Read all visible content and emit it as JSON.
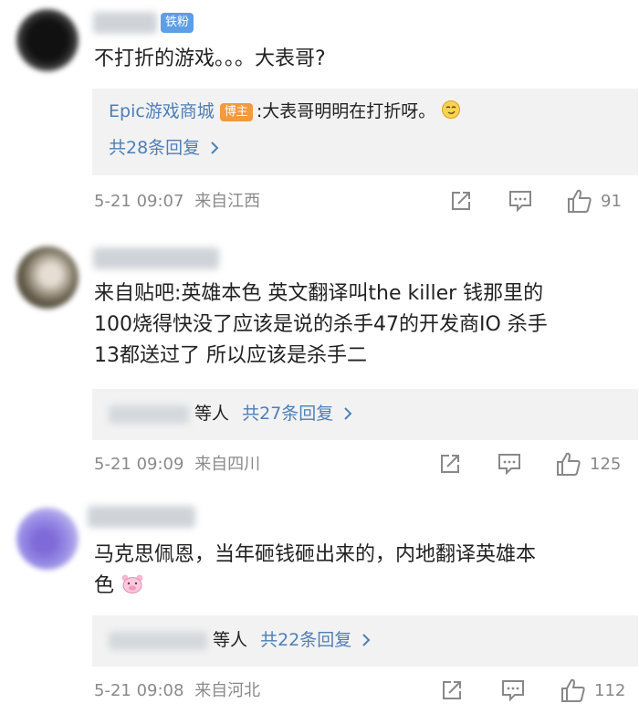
{
  "comments": [
    {
      "badge": "铁粉",
      "text": "不打折的游戏。。。大表哥?",
      "reply": {
        "author": "Epic游戏商城",
        "author_badge": "博主",
        "text": ":大表哥明明在打折呀。",
        "more": "共28条回复"
      },
      "time": "5-21 09:07",
      "location": "来自江西",
      "likes": "91"
    },
    {
      "text_lines": [
        "来自贴吧:英雄本色 英文翻译叫the killer 钱那里的",
        "100烧得快没了应该是说的杀手47的开发商IO 杀手",
        "13都送过了 所以应该是杀手二"
      ],
      "reply": {
        "etc": "等人",
        "more": "共27条回复"
      },
      "time": "5-21 09:09",
      "location": "来自四川",
      "likes": "125"
    },
    {
      "text_lines": [
        "马克思佩恩，当年砸钱砸出来的，内地翻译英雄本",
        "色"
      ],
      "reply": {
        "etc": "等人",
        "more": "共22条回复"
      },
      "time": "5-21 09:08",
      "location": "来自河北",
      "likes": "112"
    }
  ],
  "icons": {
    "share": "share-icon",
    "comment": "comment-icon",
    "like": "thumbs-up-icon",
    "chevron": "chevron-right-icon"
  },
  "colors": {
    "link": "#4d7fb8",
    "fan_badge": "#5d9ee6",
    "blogger_badge": "#f39a3a",
    "reply_bg": "#f2f2f2"
  }
}
